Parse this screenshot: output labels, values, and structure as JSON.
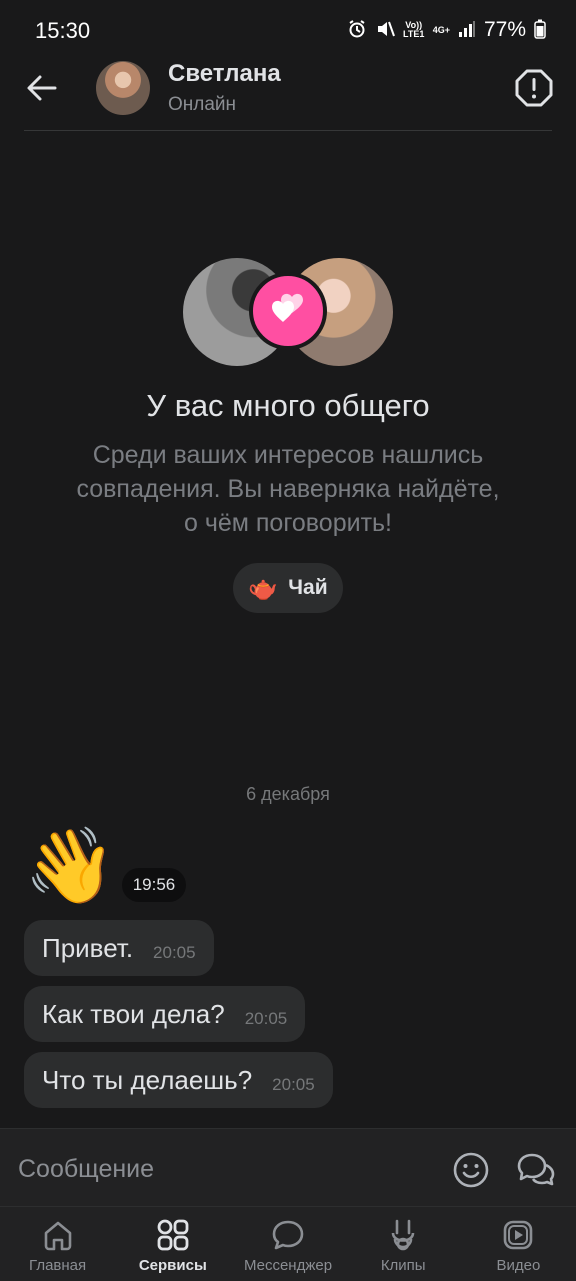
{
  "status_bar": {
    "time": "15:30",
    "volte": "Vo)) LTE1",
    "network": "4G+",
    "battery": "77%"
  },
  "header": {
    "name": "Светлана",
    "status": "Онлайн"
  },
  "match": {
    "title": "У вас много общего",
    "subtitle": "Среди ваших интересов нашлись совпадения. Вы наверняка найдёте, о чём поговорить!",
    "interest": {
      "emoji": "🫖",
      "label": "Чай"
    }
  },
  "chat": {
    "date": "6 декабря",
    "sticker": {
      "emoji": "👋",
      "time": "19:56"
    },
    "messages": [
      {
        "text": "Привет.",
        "time": "20:05"
      },
      {
        "text": "Как твои дела?",
        "time": "20:05"
      },
      {
        "text": "Что ты делаешь?",
        "time": "20:05"
      }
    ]
  },
  "composer": {
    "placeholder": "Сообщение"
  },
  "tabs": [
    {
      "label": "Главная",
      "icon": "home-icon"
    },
    {
      "label": "Сервисы",
      "icon": "services-icon",
      "active": true
    },
    {
      "label": "Мессенджер",
      "icon": "messenger-icon"
    },
    {
      "label": "Клипы",
      "icon": "clips-icon"
    },
    {
      "label": "Видео",
      "icon": "video-icon"
    }
  ],
  "colors": {
    "background": "#19191a",
    "bubble": "#2c2d2e",
    "accent_heart": "#ff4fa2"
  }
}
